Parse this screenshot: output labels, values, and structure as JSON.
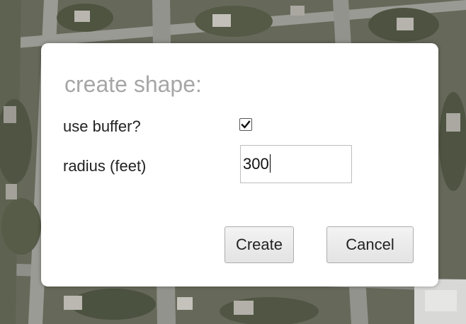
{
  "dialog": {
    "title": "create shape:",
    "buffer_label": "use buffer?",
    "buffer_checked": true,
    "radius_label": "radius (feet)",
    "radius_value": "300",
    "create_label": "Create",
    "cancel_label": "Cancel"
  },
  "colors": {
    "title_text": "#a6a6a6",
    "dialog_bg": "#ffffff"
  },
  "icons": {
    "checkmark": "checkmark-icon"
  }
}
